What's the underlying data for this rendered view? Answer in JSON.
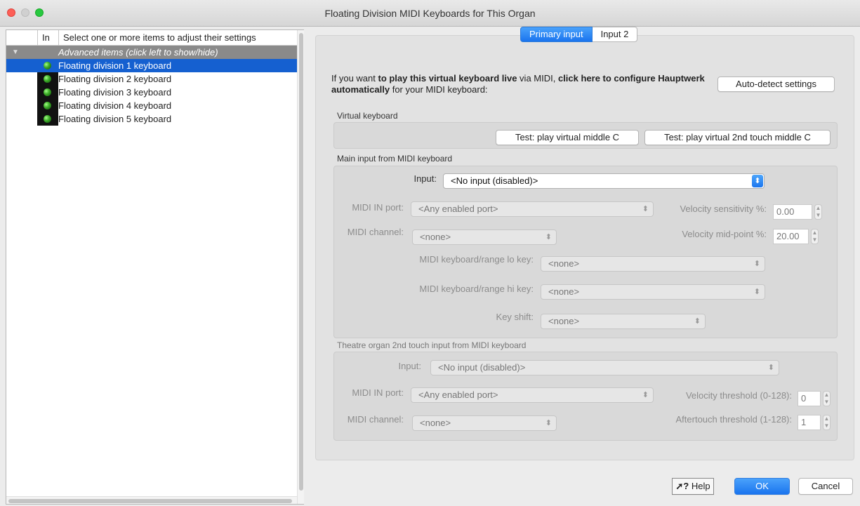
{
  "window": {
    "title": "Floating Division MIDI Keyboards for This Organ"
  },
  "tree": {
    "col_in": "In",
    "col_label": "Select one or more items to adjust their settings",
    "advanced_label": "Advanced items (click left to show/hide)",
    "items": [
      {
        "label": "Floating division 1 keyboard",
        "selected": true
      },
      {
        "label": "Floating division 2 keyboard",
        "selected": false
      },
      {
        "label": "Floating division 3 keyboard",
        "selected": false
      },
      {
        "label": "Floating division 4 keyboard",
        "selected": false
      },
      {
        "label": "Floating division 5 keyboard",
        "selected": false
      }
    ]
  },
  "tabs": {
    "primary": "Primary input",
    "input2": "Input 2"
  },
  "intro": {
    "part1": "If you want ",
    "bold1": "to play this virtual keyboard live",
    "part2": " via MIDI, ",
    "bold2": "click here to configure Hauptwerk automatically",
    "part3": " for your MIDI keyboard:"
  },
  "buttons": {
    "auto_detect": "Auto-detect settings",
    "test_middle_c": "Test: play virtual middle C",
    "test_2nd_touch": "Test: play virtual 2nd touch middle C",
    "help": "Help",
    "ok": "OK",
    "cancel": "Cancel"
  },
  "sections": {
    "virtual_keyboard": "Virtual keyboard",
    "main_input": "Main input from MIDI keyboard",
    "theatre_input": "Theatre organ 2nd touch input from MIDI keyboard"
  },
  "main": {
    "input_label": "Input:",
    "input_value": "<No input (disabled)>",
    "midi_in_port_label": "MIDI IN port:",
    "midi_in_port_value": "<Any enabled port>",
    "midi_channel_label": "MIDI channel:",
    "midi_channel_value": "<none>",
    "velocity_sensitivity_label": "Velocity sensitivity %:",
    "velocity_sensitivity_value": "0.00",
    "velocity_midpoint_label": "Velocity mid-point %:",
    "velocity_midpoint_value": "20.00",
    "range_lo_label": "MIDI keyboard/range lo key:",
    "range_lo_value": "<none>",
    "range_hi_label": "MIDI keyboard/range hi key:",
    "range_hi_value": "<none>",
    "key_shift_label": "Key shift:",
    "key_shift_value": "<none>"
  },
  "theatre": {
    "input_label": "Input:",
    "input_value": "<No input (disabled)>",
    "midi_in_port_label": "MIDI IN port:",
    "midi_in_port_value": "<Any enabled port>",
    "midi_channel_label": "MIDI channel:",
    "midi_channel_value": "<none>",
    "velocity_threshold_label": "Velocity threshold (0-128):",
    "velocity_threshold_value": "0",
    "aftertouch_threshold_label": "Aftertouch threshold (1-128):",
    "aftertouch_threshold_value": "1"
  },
  "colors": {
    "accent": "#1a74ee",
    "selection": "#1560d0",
    "advanced_row": "#8a8a8a"
  }
}
